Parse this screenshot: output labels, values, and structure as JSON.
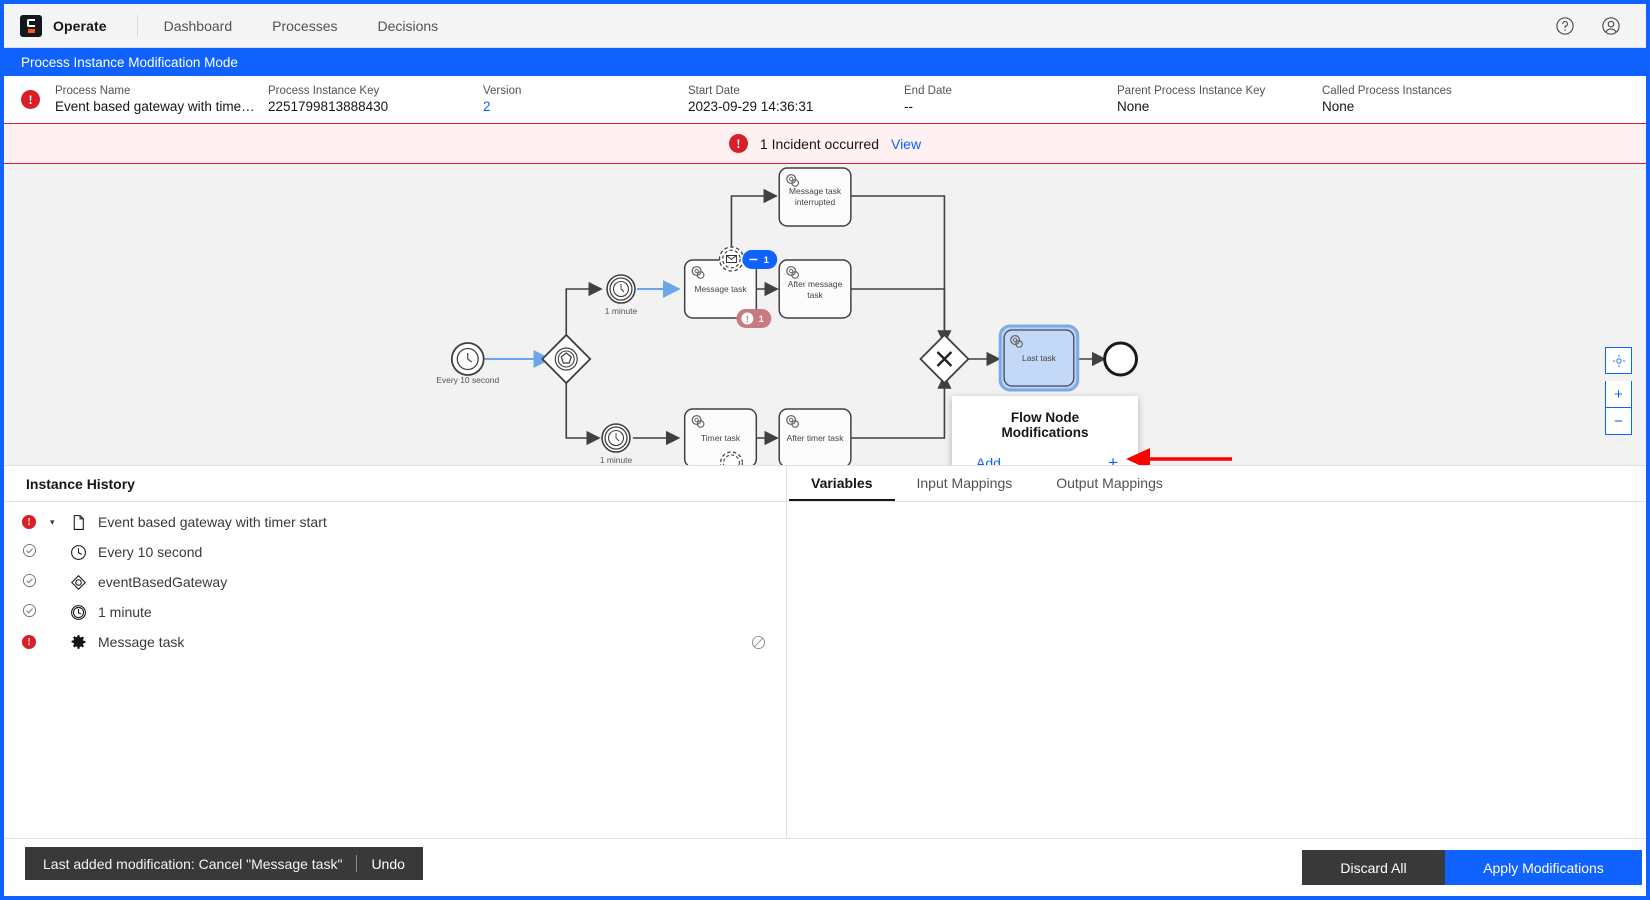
{
  "app": {
    "brand": "Operate",
    "brand_logo_icon": "camunda-logo-icon",
    "nav": [
      {
        "label": "Dashboard"
      },
      {
        "label": "Processes"
      },
      {
        "label": "Decisions"
      }
    ],
    "help_icon": "help-circle-icon",
    "user_icon": "user-avatar-icon"
  },
  "modification_banner": {
    "label": "Process Instance Modification Mode",
    "accent": "#0f62fe"
  },
  "instance_header": {
    "state_icon": "incident-error-icon",
    "fields": [
      {
        "label": "Process Name",
        "value": "Event based gateway with timer ...",
        "link": false
      },
      {
        "label": "Process Instance Key",
        "value": "2251799813888430",
        "link": false
      },
      {
        "label": "Version",
        "value": "2",
        "link": true
      },
      {
        "label": "Start Date",
        "value": "2023-09-29 14:36:31",
        "link": false
      },
      {
        "label": "End Date",
        "value": "--",
        "link": false
      },
      {
        "label": "Parent Process Instance Key",
        "value": "None",
        "link": false
      },
      {
        "label": "Called Process Instances",
        "value": "None",
        "link": false
      }
    ]
  },
  "incident_bar": {
    "icon": "incident-error-icon",
    "text": "1 Incident occurred",
    "link": "View",
    "background": "#fff1f1",
    "border": "#da1e28"
  },
  "diagram": {
    "nodes": [
      {
        "id": "start",
        "type": "timer-start-event",
        "label": "Every 10 second"
      },
      {
        "id": "gateway",
        "type": "event-based-gateway",
        "label": ""
      },
      {
        "id": "timer1",
        "type": "timer-catch-event",
        "label": "1 minute"
      },
      {
        "id": "timer2",
        "type": "timer-catch-event",
        "label": "1 minute"
      },
      {
        "id": "messageTask",
        "type": "service-task",
        "label": "Message task"
      },
      {
        "id": "messageTaskInterrupted",
        "type": "service-task",
        "label": "Message task interrupted"
      },
      {
        "id": "afterMessageTask",
        "type": "service-task",
        "label": "After message task"
      },
      {
        "id": "timerTask",
        "type": "service-task",
        "label": "Timer task"
      },
      {
        "id": "afterTimerTask",
        "type": "service-task",
        "label": "After timer task"
      },
      {
        "id": "joinGateway",
        "type": "exclusive-gateway",
        "label": ""
      },
      {
        "id": "lastTask",
        "type": "service-task",
        "label": "Last task",
        "selected": true
      },
      {
        "id": "end",
        "type": "end-event",
        "label": ""
      }
    ],
    "badges": [
      {
        "node": "messageTask",
        "kind": "cancel-modification",
        "label": "1",
        "color": "#0f62fe"
      },
      {
        "node": "messageTask",
        "kind": "incident-count",
        "label": "1",
        "color": "#c97a7e"
      }
    ],
    "popup": {
      "title": "Flow Node Modifications",
      "add_label": "Add",
      "plus_label": "+",
      "plus_icon": "plus-icon"
    },
    "annotation": {
      "type": "red-arrow",
      "color": "#ff0000"
    },
    "zoom_controls": [
      {
        "name": "reset-zoom",
        "icon": "focus-reset-icon",
        "label": ""
      },
      {
        "name": "zoom-in",
        "icon": "plus-icon",
        "label": "+"
      },
      {
        "name": "zoom-out",
        "icon": "minus-icon",
        "label": "−"
      }
    ]
  },
  "history": {
    "title": "Instance History",
    "rows": [
      {
        "state": "error",
        "caret": "▾",
        "icon": "process-file-icon",
        "label": "Event based gateway with timer start",
        "indent": 0,
        "action": null
      },
      {
        "state": "ok",
        "caret": "",
        "icon": "timer-icon",
        "label": "Every 10 second",
        "indent": 1,
        "action": null
      },
      {
        "state": "ok",
        "caret": "",
        "icon": "event-gateway-icon",
        "label": "eventBasedGateway",
        "indent": 1,
        "action": null
      },
      {
        "state": "ok",
        "caret": "",
        "icon": "timer-catch-icon",
        "label": "1 minute",
        "indent": 1,
        "action": null
      },
      {
        "state": "error",
        "caret": "",
        "icon": "service-task-gear-icon",
        "label": "Message task",
        "indent": 1,
        "action": "cancel-marker-icon"
      }
    ]
  },
  "details": {
    "tabs": [
      {
        "label": "Variables",
        "active": true
      },
      {
        "label": "Input Mappings",
        "active": false
      },
      {
        "label": "Output Mappings",
        "active": false
      }
    ]
  },
  "footer": {
    "toast": {
      "message": "Last added modification: Cancel \"Message task\"",
      "undo": "Undo"
    },
    "discard_label": "Discard All",
    "apply_label": "Apply Modifications",
    "apply_color": "#0f62fe",
    "discard_color": "#393939"
  }
}
